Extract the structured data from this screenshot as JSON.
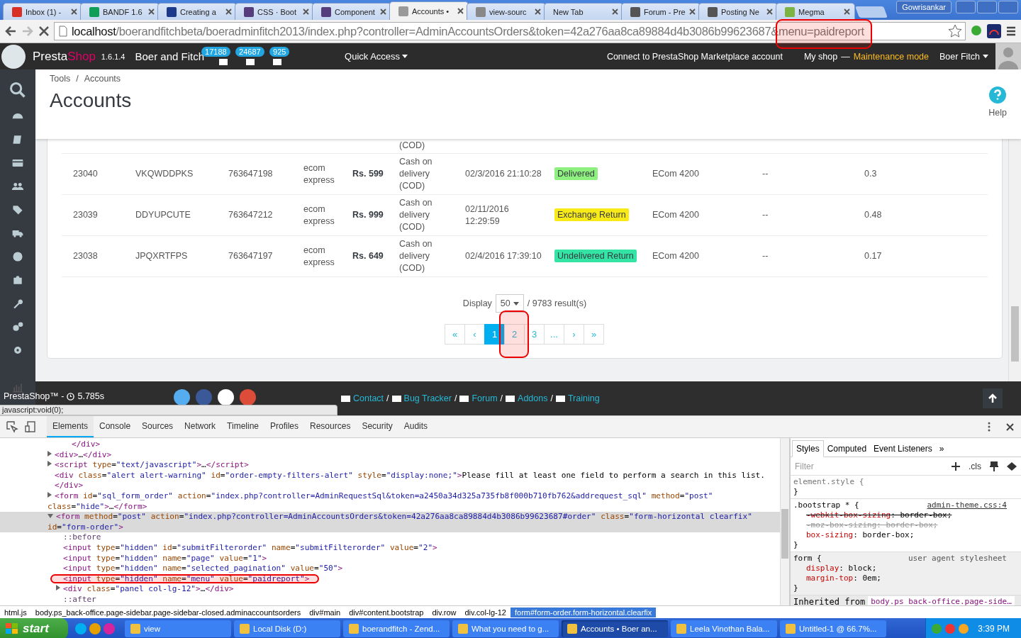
{
  "browser": {
    "tabs": [
      {
        "title": "Inbox (1) -",
        "selected": false
      },
      {
        "title": "BANDF 1.6",
        "selected": false
      },
      {
        "title": "Creating a",
        "selected": false
      },
      {
        "title": "CSS · Boot",
        "selected": false
      },
      {
        "title": "Component",
        "selected": false
      },
      {
        "title": "Accounts •",
        "selected": true
      },
      {
        "title": "view-sourc",
        "selected": false
      },
      {
        "title": "New Tab",
        "selected": false
      },
      {
        "title": "Forum - Pre",
        "selected": false
      },
      {
        "title": "Posting Ne",
        "selected": false
      },
      {
        "title": "Megma",
        "selected": false
      }
    ],
    "user": "Gowrisankar",
    "url": {
      "host": "localhost",
      "path": "/boerandfitchbeta/boeradminfitch2013/index.php?controller=AdminAccountsOrders&token=42a276aa8ca89884d4b3086b99623687&",
      "param": "menu=paidreport",
      "circled": true
    }
  },
  "header": {
    "brand_a": "Presta",
    "brand_b": "Shop",
    "version": "1.6.1.4",
    "shop": "Boer and Fitch",
    "badges": [
      "17188",
      "24687",
      "925"
    ],
    "quick_access": "Quick Access",
    "marketplace": "Connect to PrestaShop Marketplace account",
    "my_shop": "My shop",
    "dash": "—",
    "maintenance": "Maintenance mode",
    "employee": "Boer Fitch"
  },
  "breadcrumb": [
    "Tools",
    "/",
    "Accounts"
  ],
  "title": "Accounts",
  "help": "Help",
  "table": {
    "top_row_partial": {
      "payment": "(COD)"
    },
    "rows": [
      {
        "cells": [
          {
            "text": "23040",
            "kind": "text"
          },
          {
            "text": "VKQWDDPKS",
            "kind": "text"
          },
          {
            "text": "763647198",
            "kind": "text"
          },
          {
            "text": "ecom express",
            "kind": "text"
          },
          {
            "text": "Rs. 599",
            "kind": "bold"
          },
          {
            "text": "Cash on delivery (COD)",
            "kind": "text"
          },
          {
            "text": "02/3/2016 21:10:28",
            "kind": "text"
          },
          {
            "text": "Delivered",
            "kind": "badge",
            "color": "#8ef07e"
          },
          {
            "text": "ECom 4200",
            "kind": "text"
          },
          {
            "text": "--",
            "kind": "text"
          },
          {
            "text": "0.3",
            "kind": "text"
          }
        ]
      },
      {
        "cells": [
          {
            "text": "23039",
            "kind": "text"
          },
          {
            "text": "DDYUPCUTE",
            "kind": "text"
          },
          {
            "text": "763647212",
            "kind": "text"
          },
          {
            "text": "ecom express",
            "kind": "text"
          },
          {
            "text": "Rs. 999",
            "kind": "bold"
          },
          {
            "text": "Cash on delivery (COD)",
            "kind": "text"
          },
          {
            "text": "02/11/2016 12:29:59",
            "kind": "text"
          },
          {
            "text": "Exchange Return",
            "kind": "badge",
            "color": "#f8ea18"
          },
          {
            "text": "ECom 4200",
            "kind": "text"
          },
          {
            "text": "--",
            "kind": "text"
          },
          {
            "text": "0.48",
            "kind": "text"
          }
        ]
      },
      {
        "cells": [
          {
            "text": "23038",
            "kind": "text"
          },
          {
            "text": "JPQXRTFPS",
            "kind": "text"
          },
          {
            "text": "763647197",
            "kind": "text"
          },
          {
            "text": "ecom express",
            "kind": "text"
          },
          {
            "text": "Rs. 649",
            "kind": "bold"
          },
          {
            "text": "Cash on delivery (COD)",
            "kind": "text"
          },
          {
            "text": "02/4/2016 17:39:10",
            "kind": "text"
          },
          {
            "text": "Undelivered Return",
            "kind": "badge",
            "color": "#33e4a4"
          },
          {
            "text": "ECom 4200",
            "kind": "text"
          },
          {
            "text": "--",
            "kind": "text"
          },
          {
            "text": "0.17",
            "kind": "text"
          }
        ]
      }
    ]
  },
  "pagination": {
    "display_label": "Display",
    "per_page": "50",
    "results": "/ 9783 result(s)",
    "buttons": [
      {
        "label": "«",
        "selected": false,
        "circled": false
      },
      {
        "label": "‹",
        "selected": false,
        "circled": false
      },
      {
        "label": "1",
        "selected": true,
        "circled": false
      },
      {
        "label": "2",
        "selected": false,
        "circled": true
      },
      {
        "label": "3",
        "selected": false,
        "circled": false
      },
      {
        "label": "...",
        "selected": false,
        "circled": false
      },
      {
        "label": "›",
        "selected": false,
        "circled": false
      },
      {
        "label": "»",
        "selected": false,
        "circled": false
      }
    ]
  },
  "footer": {
    "brand": "PrestaShop™ -",
    "time": "5.785s",
    "links": [
      {
        "label": "Contact",
        "sep": "/"
      },
      {
        "label": "Bug Tracker",
        "sep": "/"
      },
      {
        "label": "Forum",
        "sep": "/"
      },
      {
        "label": "Addons",
        "sep": "/"
      },
      {
        "label": "Training"
      }
    ],
    "status_url": "javascript:void(0);"
  },
  "devtools": {
    "tabs": [
      {
        "label": "Elements",
        "selected": true
      },
      {
        "label": "Console",
        "selected": false
      },
      {
        "label": "Sources",
        "selected": false
      },
      {
        "label": "Network",
        "selected": false
      },
      {
        "label": "Timeline",
        "selected": false
      },
      {
        "label": "Profiles",
        "selected": false
      },
      {
        "label": "Resources",
        "selected": false
      },
      {
        "label": "Security",
        "selected": false
      },
      {
        "label": "Audits",
        "selected": false
      }
    ],
    "tree": [
      {
        "children": [
          {
            "text": "</div>",
            "kind": "tag",
            "selected": false,
            "circled": false
          }
        ]
      },
      {
        "text": "<div>…</div>",
        "kind": "tag",
        "expanded": false,
        "selected": false,
        "circled": false
      },
      {
        "text": "<script type=\"text/javascript\">…</script>",
        "kind": "tag",
        "expanded": false,
        "selected": false,
        "circled": false
      },
      {
        "text": "<div class=\"alert alert-warning\" id=\"order-empty-filters-alert\" style=\"display:none;\">Please fill at least one field to perform a search in this list.</div>",
        "kind": "tag",
        "selected": false,
        "circled": false
      },
      {
        "text": "<form id=\"sql_form_order\" action=\"index.php?controller=AdminRequestSql&token=a2450a34d325a735fb8f000b710fb762&addrequest_sql\" method=\"post\" class=\"hide\">…</form>",
        "kind": "tag",
        "expanded": false,
        "selected": false,
        "circled": false
      },
      {
        "text": "<form method=\"post\" action=\"index.php?controller=AdminAccountsOrders&token=42a276aa8ca89884d4b3086b99623687#order\" class=\"form-horizontal clearfix\" id=\"form-order\">",
        "kind": "tag",
        "expanded": true,
        "selected": true,
        "circled": false,
        "children": [
          {
            "text": "::before",
            "kind": "pseudo",
            "selected": false,
            "circled": false
          },
          {
            "text": "<input type=\"hidden\" id=\"submitFilterorder\" name=\"submitFilterorder\" value=\"2\">",
            "kind": "tag",
            "selected": false,
            "circled": false
          },
          {
            "text": "<input type=\"hidden\" name=\"page\" value=\"1\">",
            "kind": "tag",
            "selected": false,
            "circled": false
          },
          {
            "text": "<input type=\"hidden\" name=\"selected_pagination\" value=\"50\">",
            "kind": "tag",
            "selected": false,
            "circled": false
          },
          {
            "text": "<input type=\"hidden\" name=\"menu\" value=\"paidreport\">",
            "kind": "tag",
            "selected": false,
            "circled": true
          },
          {
            "text": "<div class=\"panel col-lg-12\">…</div>",
            "kind": "tag",
            "expanded": false,
            "selected": false,
            "circled": false
          },
          {
            "text": "::after",
            "kind": "pseudo",
            "selected": false,
            "circled": false
          }
        ]
      }
    ],
    "path": [
      {
        "label": "html.js",
        "selected": false
      },
      {
        "label": "body.ps_back-office.page-sidebar.page-sidebar-closed.adminaccountsorders",
        "selected": false
      },
      {
        "label": "div#main",
        "selected": false
      },
      {
        "label": "div#content.bootstrap",
        "selected": false
      },
      {
        "label": "div.row",
        "selected": false
      },
      {
        "label": "div.col-lg-12",
        "selected": false
      },
      {
        "label": "form#form-order.form-horizontal.clearfix",
        "selected": true
      }
    ],
    "styles_tabs": [
      {
        "label": "Styles",
        "selected": true
      },
      {
        "label": "Computed",
        "selected": false
      },
      {
        "label": "Event Listeners",
        "selected": false
      }
    ],
    "more": "»",
    "filter_placeholder": "Filter",
    "cls": ".cls",
    "rules": [
      {
        "head": "element.style {",
        "tail": "}",
        "shaded": false
      },
      {
        "head": ".bootstrap * {",
        "source": "admin-theme.css:4",
        "tail": "}",
        "shaded": false,
        "props": [
          {
            "text": "-webkit-box-sizing: border-box;",
            "struck": true,
            "greyed": false
          },
          {
            "text": "-moz-box-sizing: border-box;",
            "struck": true,
            "greyed": true
          },
          {
            "text": "box-sizing: border-box;",
            "struck": false,
            "greyed": false
          }
        ]
      },
      {
        "head": "form {",
        "source": "user agent stylesheet",
        "tail": "}",
        "shaded": true,
        "props": [
          {
            "text": "display: block;",
            "struck": false,
            "greyed": false
          },
          {
            "text": "margin-top: 0em;",
            "struck": false,
            "greyed": false
          }
        ]
      }
    ],
    "inherited_label": "Inherited from",
    "inherited_selector": "body.ps_back-office.page-side…"
  },
  "taskbar": {
    "start": "start",
    "tasks": [
      {
        "label": "view",
        "selected": false
      },
      {
        "label": "Local Disk (D:)",
        "selected": false
      },
      {
        "label": "boerandfitch - Zend...",
        "selected": false
      },
      {
        "label": "What you need to g...",
        "selected": false
      },
      {
        "label": "Accounts • Boer an...",
        "selected": true
      },
      {
        "label": "Leela Vinothan Bala...",
        "selected": false
      },
      {
        "label": "Untitled-1 @ 66.7%...",
        "selected": false
      }
    ],
    "clock": "3:39 PM"
  }
}
